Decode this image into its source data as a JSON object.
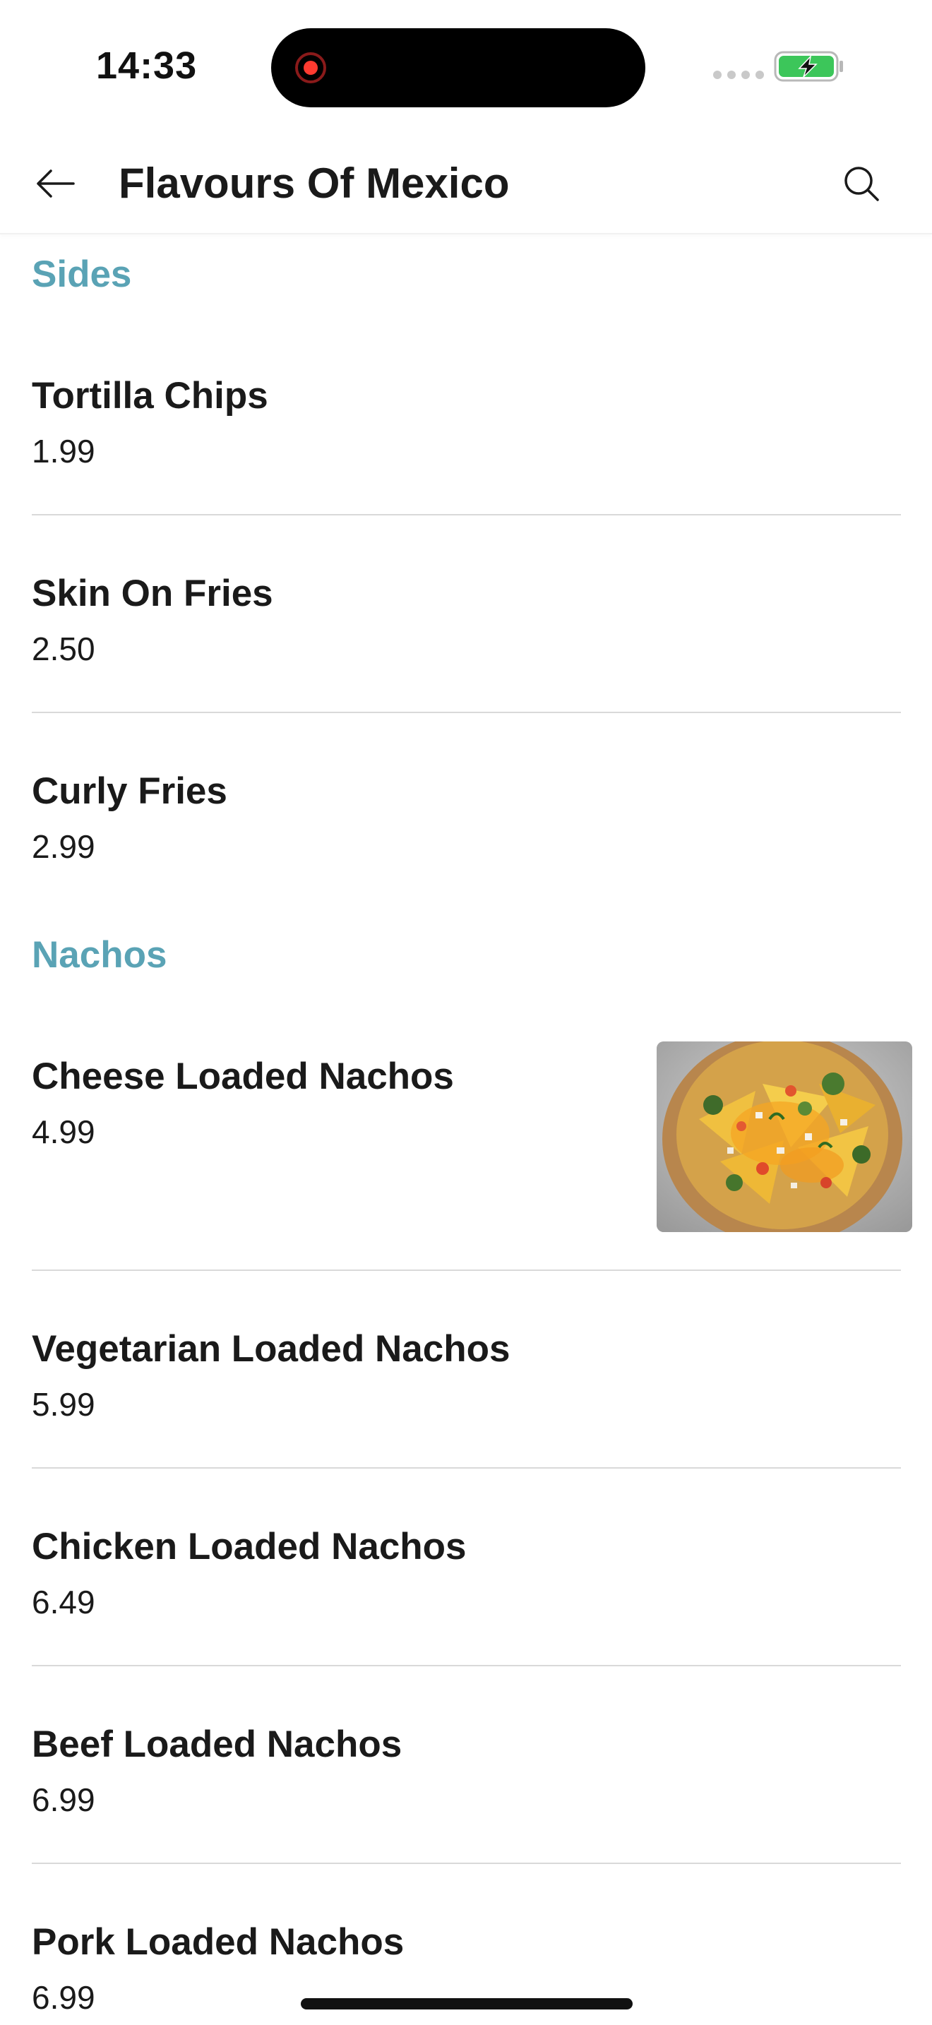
{
  "status_bar": {
    "time": "14:33",
    "recording_indicator": "record-dot-icon",
    "battery_icon": "battery-charging-icon",
    "battery_color": "#3cc65a"
  },
  "header": {
    "title": "Flavours Of Mexico",
    "back_icon": "back-arrow-icon",
    "search_icon": "search-icon"
  },
  "theme": {
    "section_color": "#5aa3b5",
    "text_color": "#1a1a1a",
    "divider_color": "#d9d9d9"
  },
  "sections": [
    {
      "title": "Sides",
      "items": [
        {
          "name": "Tortilla Chips",
          "price": "1.99"
        },
        {
          "name": "Skin On Fries",
          "price": "2.50"
        },
        {
          "name": "Curly Fries",
          "price": "2.99"
        }
      ]
    },
    {
      "title": "Nachos",
      "items": [
        {
          "name": "Cheese Loaded Nachos",
          "price": "4.99",
          "image": "nachos-photo"
        },
        {
          "name": "Vegetarian Loaded Nachos",
          "price": "5.99"
        },
        {
          "name": "Chicken Loaded Nachos",
          "price": "6.49"
        },
        {
          "name": "Beef Loaded Nachos",
          "price": "6.99"
        },
        {
          "name": "Pork Loaded Nachos",
          "price": "6.99"
        }
      ]
    }
  ]
}
